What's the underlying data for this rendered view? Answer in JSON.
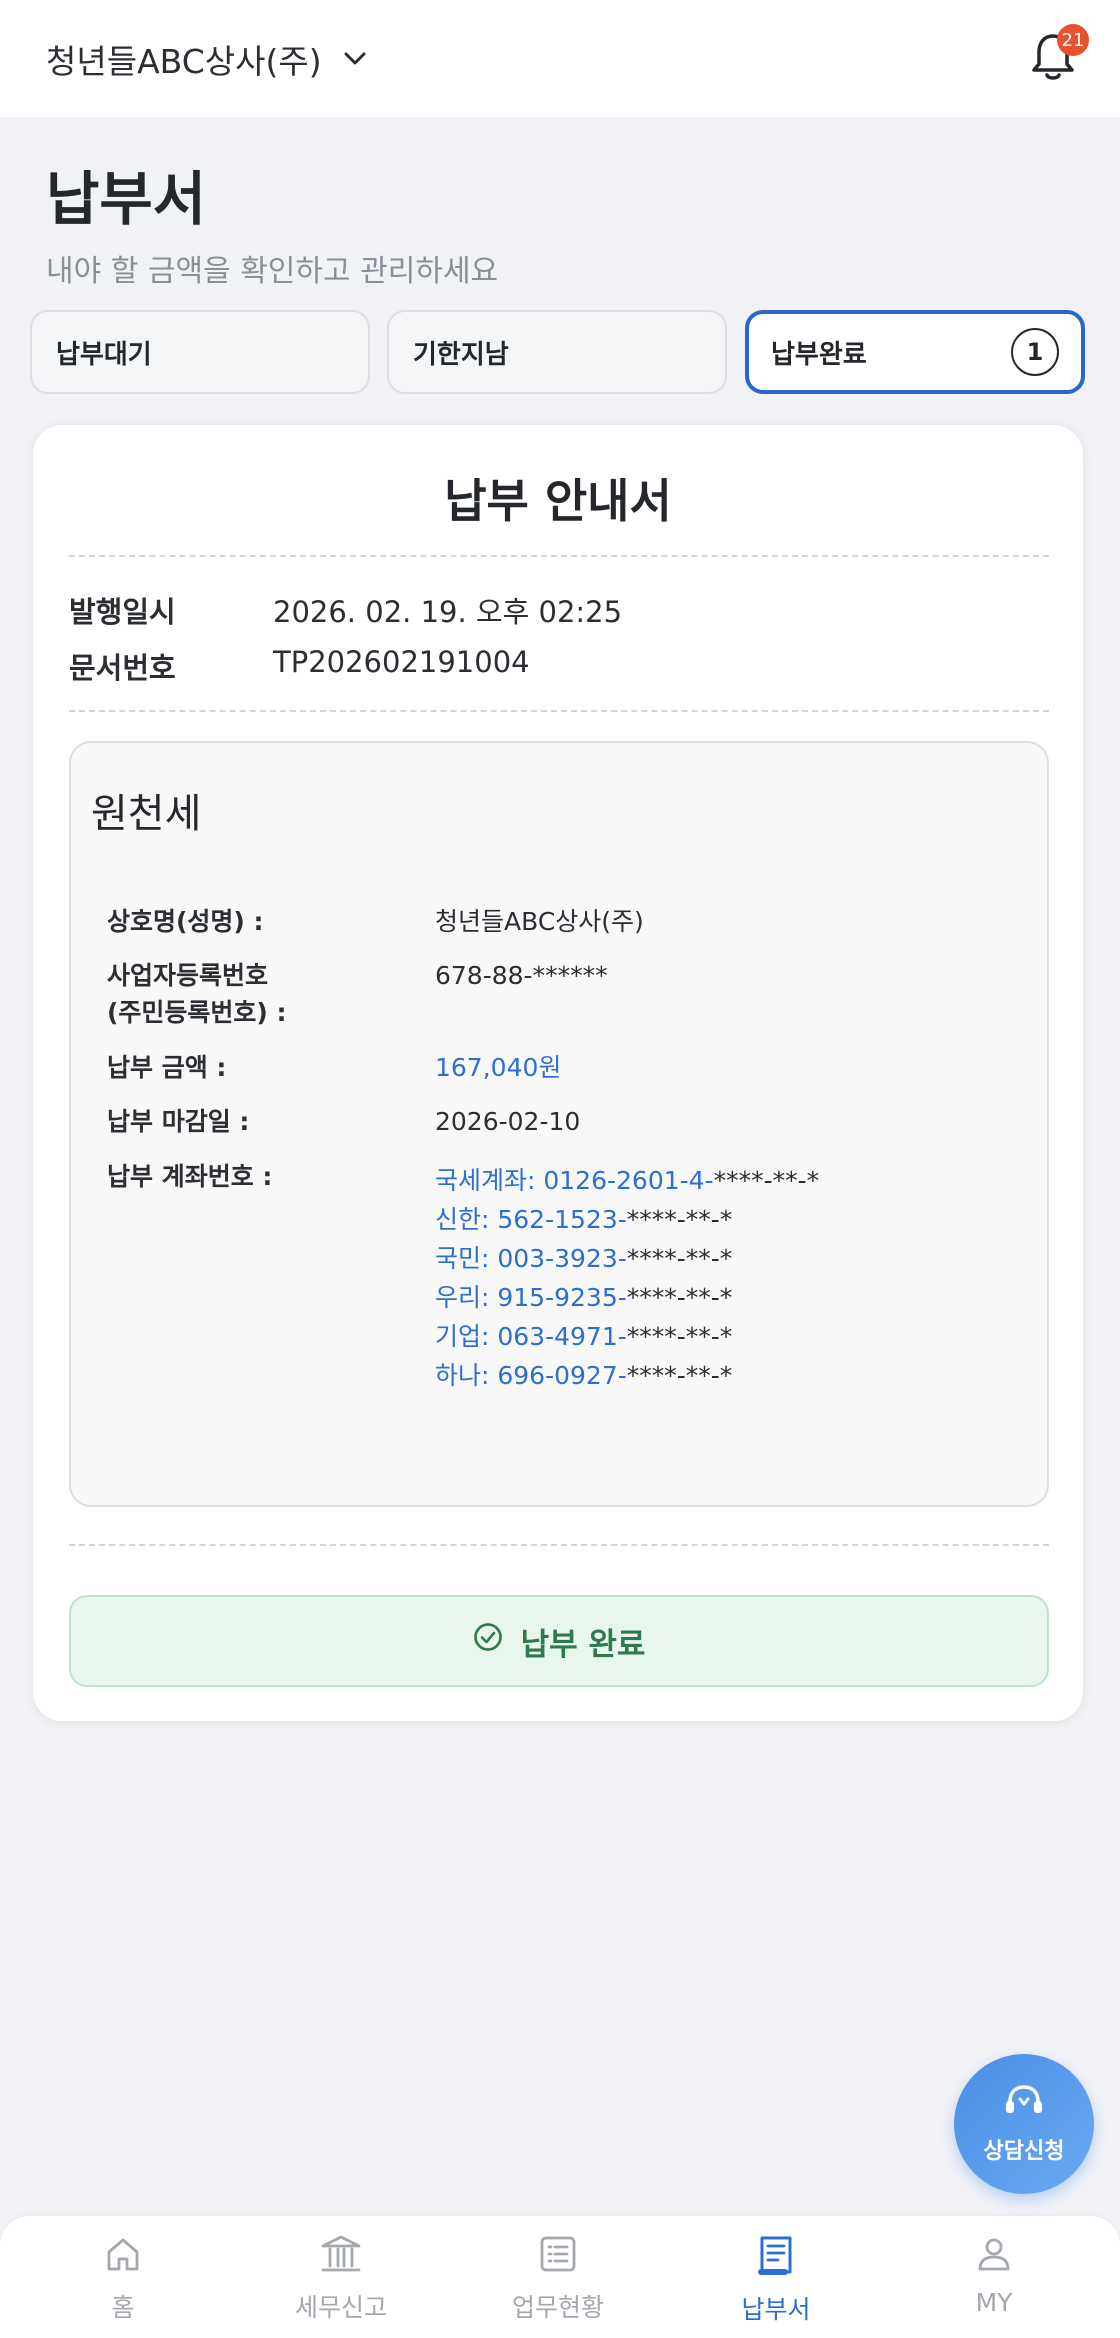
{
  "header": {
    "company": "청년들ABC상사(주)",
    "notification_count": "21"
  },
  "page": {
    "title": "납부서",
    "subtitle": "내야 할 금액을 확인하고 관리하세요"
  },
  "tabs": [
    {
      "label": "납부대기",
      "active": false
    },
    {
      "label": "기한지남",
      "active": false
    },
    {
      "label": "납부완료",
      "active": true,
      "count": "1"
    }
  ],
  "notice": {
    "title": "납부 안내서",
    "issued_label": "발행일시",
    "issued_value": "2026. 02. 19. 오후 02:25",
    "docno_label": "문서번호",
    "docno_value": "TP202602191004",
    "tax": {
      "title": "원천세",
      "name_label": "상호명(성명) :",
      "name_value": "청년들ABC상사(주)",
      "bizno_label_1": "사업자등록번호",
      "bizno_label_2": "(주민등록번호) :",
      "bizno_value": "678-88-******",
      "amount_label": "납부 금액 :",
      "amount_value": "167,040원",
      "due_label": "납부 마감일 :",
      "due_value": "2026-02-10",
      "account_label": "납부 계좌번호 :",
      "accounts": [
        {
          "prefix": "국세계좌: 0126-2601-4-",
          "mask": "****-**-*"
        },
        {
          "prefix": "신한: 562-1523-",
          "mask": "****-**-*"
        },
        {
          "prefix": "국민: 003-3923-",
          "mask": "****-**-*"
        },
        {
          "prefix": "우리: 915-9235-",
          "mask": "****-**-*"
        },
        {
          "prefix": "기업: 063-4971-",
          "mask": "****-**-*"
        },
        {
          "prefix": "하나: 696-0927-",
          "mask": "****-**-*"
        }
      ]
    },
    "status_label": "납부 완료"
  },
  "fab_label": "상담신청",
  "bottom_nav": [
    {
      "label": "홈",
      "icon": "home-icon"
    },
    {
      "label": "세무신고",
      "icon": "bank-icon"
    },
    {
      "label": "업무현황",
      "icon": "list-icon"
    },
    {
      "label": "납부서",
      "icon": "receipt-icon",
      "active": true
    },
    {
      "label": "MY",
      "icon": "user-icon"
    }
  ],
  "colors": {
    "accent": "#2a67c9",
    "badge": "#e8502e",
    "success": "#2f7a4d"
  }
}
